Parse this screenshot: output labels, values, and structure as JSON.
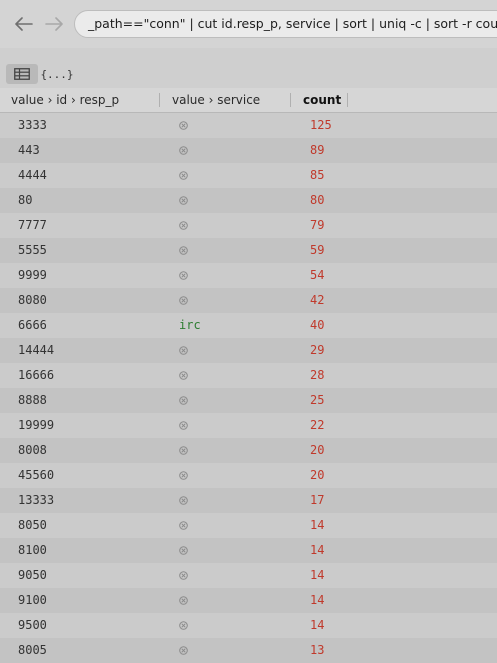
{
  "toolbar": {
    "back_icon": "arrow-left-icon",
    "forward_icon": "arrow-right-icon",
    "query": "_path==\"conn\" | cut id.resp_p, service | sort | uniq -c | sort -r count"
  },
  "viewbar": {
    "table_icon": "table-icon",
    "json_label": "{...}"
  },
  "table": {
    "headers": [
      "value › id › resp_p",
      "value › service",
      "count"
    ],
    "rows": [
      {
        "port": "3333",
        "service": null,
        "count": "125"
      },
      {
        "port": "443",
        "service": null,
        "count": "89"
      },
      {
        "port": "4444",
        "service": null,
        "count": "85"
      },
      {
        "port": "80",
        "service": null,
        "count": "80"
      },
      {
        "port": "7777",
        "service": null,
        "count": "79"
      },
      {
        "port": "5555",
        "service": null,
        "count": "59"
      },
      {
        "port": "9999",
        "service": null,
        "count": "54"
      },
      {
        "port": "8080",
        "service": null,
        "count": "42"
      },
      {
        "port": "6666",
        "service": "irc",
        "count": "40"
      },
      {
        "port": "14444",
        "service": null,
        "count": "29"
      },
      {
        "port": "16666",
        "service": null,
        "count": "28"
      },
      {
        "port": "8888",
        "service": null,
        "count": "25"
      },
      {
        "port": "19999",
        "service": null,
        "count": "22"
      },
      {
        "port": "8008",
        "service": null,
        "count": "20"
      },
      {
        "port": "45560",
        "service": null,
        "count": "20"
      },
      {
        "port": "13333",
        "service": null,
        "count": "17"
      },
      {
        "port": "8050",
        "service": null,
        "count": "14"
      },
      {
        "port": "8100",
        "service": null,
        "count": "14"
      },
      {
        "port": "9050",
        "service": null,
        "count": "14"
      },
      {
        "port": "9100",
        "service": null,
        "count": "14"
      },
      {
        "port": "9500",
        "service": null,
        "count": "14"
      },
      {
        "port": "8005",
        "service": null,
        "count": "13"
      }
    ]
  },
  "colors": {
    "count": "#c0392b",
    "service": "#2e7d32",
    "null_icon": "#8a8a8a"
  }
}
